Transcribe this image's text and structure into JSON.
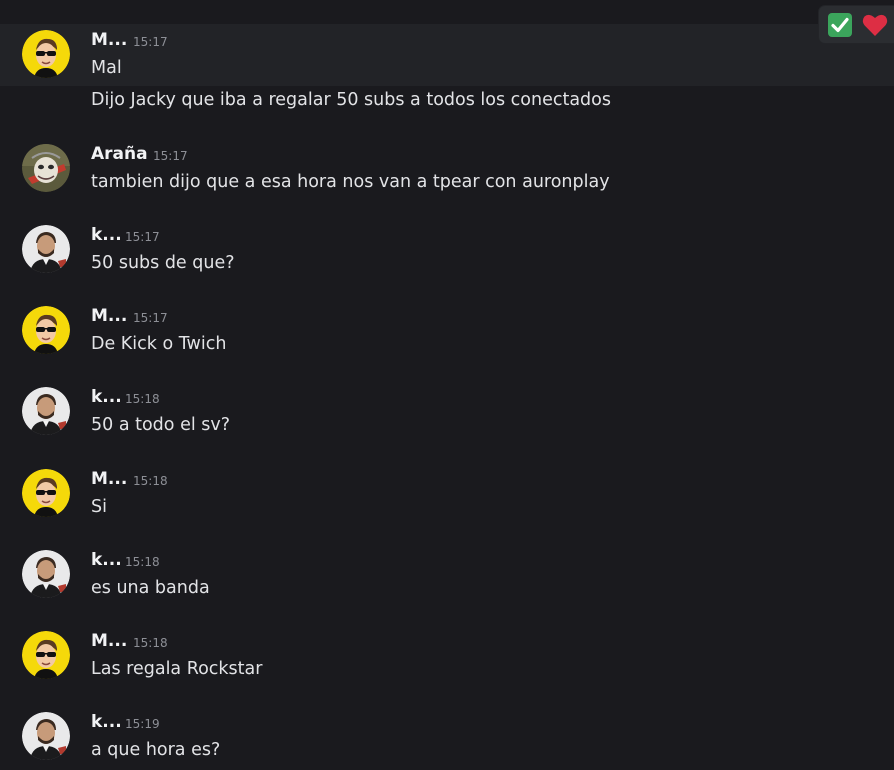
{
  "messages": [
    {
      "author": "M...",
      "time": "15:17",
      "lines": [
        "Mal",
        "Dijo Jacky que iba a regalar 50 subs a todos los conectados"
      ],
      "avatar": "sunglasses-avatar"
    },
    {
      "author": "Araña",
      "time": "15:17",
      "lines": [
        "tambien dijo que a esa hora nos van a tpear con auronplay"
      ],
      "avatar": "spider-avatar"
    },
    {
      "author": "k...",
      "time": "15:17",
      "lines": [
        "50 subs de que?"
      ],
      "avatar": "suit-avatar"
    },
    {
      "author": "M...",
      "time": "15:17",
      "lines": [
        "De Kick o Twich"
      ],
      "avatar": "sunglasses-avatar"
    },
    {
      "author": "k...",
      "time": "15:18",
      "lines": [
        "50 a todo el sv?"
      ],
      "avatar": "suit-avatar"
    },
    {
      "author": "M...",
      "time": "15:18",
      "lines": [
        "Si"
      ],
      "avatar": "sunglasses-avatar"
    },
    {
      "author": "k...",
      "time": "15:18",
      "lines": [
        "es una banda"
      ],
      "avatar": "suit-avatar"
    },
    {
      "author": "M...",
      "time": "15:18",
      "lines": [
        "Las regala Rockstar"
      ],
      "avatar": "sunglasses-avatar"
    },
    {
      "author": "k...",
      "time": "15:19",
      "lines": [
        "a que hora es?"
      ],
      "avatar": "suit-avatar"
    }
  ],
  "reactions": [
    {
      "icon": "check-mark-icon",
      "color": "#3ba55c"
    },
    {
      "icon": "heart-icon",
      "color": "#dd2e44"
    }
  ]
}
